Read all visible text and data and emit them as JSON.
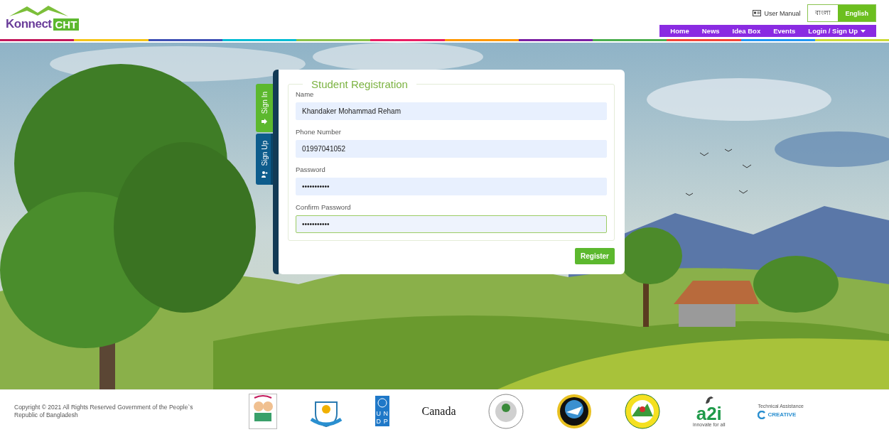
{
  "header": {
    "logo": {
      "word": "Konnect",
      "badge": "CHT"
    },
    "user_manual": "User Manual",
    "languages": [
      {
        "label": "বাংলা",
        "selected": false
      },
      {
        "label": "English",
        "selected": true
      }
    ],
    "nav": [
      {
        "label": "Home",
        "dropdown": false
      },
      {
        "label": "News",
        "dropdown": false
      },
      {
        "label": "Idea Box",
        "dropdown": false
      },
      {
        "label": "Events",
        "dropdown": false
      },
      {
        "label": "Login / Sign Up",
        "dropdown": true
      }
    ]
  },
  "side_tabs": [
    {
      "label": "Sign In",
      "kind": "signin",
      "selected": false
    },
    {
      "label": "Sign Up",
      "kind": "signup",
      "selected": true
    }
  ],
  "form": {
    "title": "Student Registration",
    "fields": [
      {
        "label": "Name",
        "value": "Khandaker Mohammad Reham",
        "focused": false
      },
      {
        "label": "Phone Number",
        "value": "01997041052",
        "focused": false
      },
      {
        "label": "Password",
        "value": "•••••••••••",
        "focused": false
      },
      {
        "label": "Confirm Password",
        "value": "•••••••••••",
        "focused": true
      }
    ],
    "submit": "Register"
  },
  "footer": {
    "copyright": "Copyright © 2021 All Rights Reserved Government of the People`s Republic of Bangladesh",
    "partners": [
      {
        "kind": "primary-edu"
      },
      {
        "kind": "crest"
      },
      {
        "kind": "undp",
        "letters": [
          "U",
          "N",
          "D",
          "P"
        ]
      },
      {
        "kind": "wordmark",
        "text": "Canada"
      },
      {
        "kind": "seal-grey"
      },
      {
        "kind": "seal-dark"
      },
      {
        "kind": "seal-yellow"
      },
      {
        "kind": "a2i",
        "text": "a2i",
        "tagline": "innovate for all"
      },
      {
        "kind": "creative",
        "caption": "Technical Assistance",
        "text": "CREATIVE"
      }
    ]
  }
}
